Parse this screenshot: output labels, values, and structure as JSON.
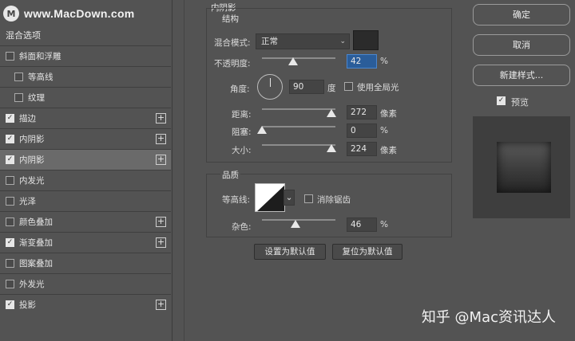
{
  "watermark": {
    "logo": "M",
    "text": "www.MacDown.com"
  },
  "sidebar": {
    "blend_options": "混合选项",
    "items": [
      {
        "label": "斜面和浮雕",
        "checked": false,
        "plus": false,
        "indent": false,
        "selected": false
      },
      {
        "label": "等高线",
        "checked": false,
        "plus": false,
        "indent": true,
        "selected": false
      },
      {
        "label": "纹理",
        "checked": false,
        "plus": false,
        "indent": true,
        "selected": false
      },
      {
        "label": "描边",
        "checked": true,
        "plus": true,
        "indent": false,
        "selected": false
      },
      {
        "label": "内阴影",
        "checked": true,
        "plus": true,
        "indent": false,
        "selected": false
      },
      {
        "label": "内阴影",
        "checked": true,
        "plus": true,
        "indent": false,
        "selected": true
      },
      {
        "label": "内发光",
        "checked": false,
        "plus": false,
        "indent": false,
        "selected": false
      },
      {
        "label": "光泽",
        "checked": false,
        "plus": false,
        "indent": false,
        "selected": false
      },
      {
        "label": "颜色叠加",
        "checked": false,
        "plus": true,
        "indent": false,
        "selected": false
      },
      {
        "label": "渐变叠加",
        "checked": true,
        "plus": true,
        "indent": false,
        "selected": false
      },
      {
        "label": "图案叠加",
        "checked": false,
        "plus": false,
        "indent": false,
        "selected": false
      },
      {
        "label": "外发光",
        "checked": false,
        "plus": false,
        "indent": false,
        "selected": false
      },
      {
        "label": "投影",
        "checked": true,
        "plus": true,
        "indent": false,
        "selected": false
      }
    ],
    "plus_glyph": "+",
    "check_glyph": "✓"
  },
  "panel": {
    "title": "内阴影",
    "structure": {
      "title": "结构",
      "blend_mode_label": "混合模式:",
      "blend_mode_value": "正常",
      "blend_mode_arrow": "⌄",
      "shadow_color": "#2b2b2b",
      "opacity_label": "不透明度:",
      "opacity_value": "42",
      "opacity_unit": "%",
      "opacity_fraction": 0.42,
      "angle_label": "角度:",
      "angle_value": "90",
      "angle_unit": "度",
      "global_light_label": "使用全局光",
      "global_light_checked": false,
      "distance_label": "距离:",
      "distance_value": "272",
      "distance_unit": "像素",
      "distance_fraction": 0.95,
      "choke_label": "阻塞:",
      "choke_value": "0",
      "choke_unit": "%",
      "choke_fraction": 0.0,
      "size_label": "大小:",
      "size_value": "224",
      "size_unit": "像素",
      "size_fraction": 0.95
    },
    "quality": {
      "title": "品质",
      "contour_label": "等高线:",
      "antialias_label": "消除锯齿",
      "antialias_checked": false,
      "contour_arrow": "⌄",
      "noise_label": "杂色:",
      "noise_value": "46",
      "noise_unit": "%",
      "noise_fraction": 0.46
    },
    "buttons": {
      "set_default": "设置为默认值",
      "reset_default": "复位为默认值"
    }
  },
  "right": {
    "ok": "确定",
    "cancel": "取消",
    "new_style": "新建样式...",
    "preview_label": "预览",
    "preview_checked": true
  },
  "overlay": {
    "zhihu_text": "知乎 @Mac资讯达人"
  }
}
